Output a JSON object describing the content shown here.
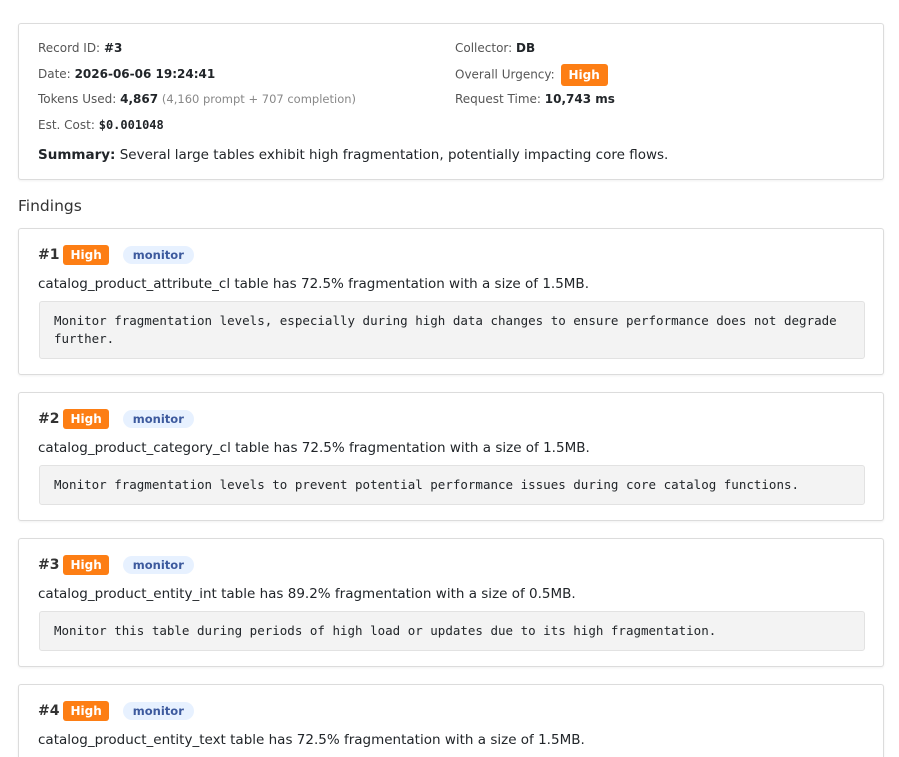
{
  "record": {
    "id_label": "Record ID:",
    "id_value": "#3",
    "date_label": "Date:",
    "date_value": "2026-06-06 19:24:41",
    "tokens_label": "Tokens Used:",
    "tokens_value": "4,867",
    "tokens_detail": "(4,160 prompt + 707 completion)",
    "cost_label": "Est. Cost:",
    "cost_value": "$0.001048",
    "collector_label": "Collector:",
    "collector_value": "DB",
    "urgency_label": "Overall Urgency:",
    "urgency_value": "High",
    "request_time_label": "Request Time:",
    "request_time_value": "10,743 ms",
    "summary_label": "Summary:",
    "summary_text": "Several large tables exhibit high fragmentation, potentially impacting core flows."
  },
  "findings_title": "Findings",
  "findings": [
    {
      "num": "#1",
      "urgency": "High",
      "tag": "monitor",
      "description": "catalog_product_attribute_cl table has 72.5% fragmentation with a size of 1.5MB.",
      "recommendation": "Monitor fragmentation levels, especially during high data changes to ensure performance does not degrade further."
    },
    {
      "num": "#2",
      "urgency": "High",
      "tag": "monitor",
      "description": "catalog_product_category_cl table has 72.5% fragmentation with a size of 1.5MB.",
      "recommendation": "Monitor fragmentation levels to prevent potential performance issues during core catalog functions."
    },
    {
      "num": "#3",
      "urgency": "High",
      "tag": "monitor",
      "description": "catalog_product_entity_int table has 89.2% fragmentation with a size of 0.5MB.",
      "recommendation": "Monitor this table during periods of high load or updates due to its high fragmentation."
    },
    {
      "num": "#4",
      "urgency": "High",
      "tag": "monitor",
      "description": "catalog_product_entity_text table has 72.5% fragmentation with a size of 1.5MB."
    }
  ],
  "colors": {
    "urgency_high": "#fd7e14",
    "tag_bg": "#e7f1ff",
    "tag_text": "#3d5a9e"
  }
}
